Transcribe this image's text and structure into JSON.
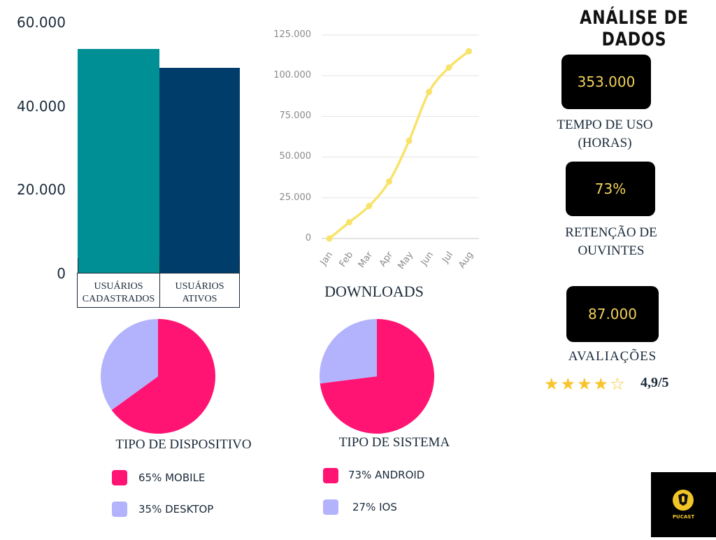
{
  "title": "ANÁLISE DE DADOS",
  "colors": {
    "teal": "#008f94",
    "navy": "#003d6b",
    "yellow": "#f8e36a",
    "pink": "#ff1473",
    "lavender": "#b3b3fd",
    "kpi_text": "#f2d25a"
  },
  "chart_data": [
    {
      "type": "bar",
      "categories": [
        "USUÁRIOS CADASTRADOS",
        "USUÁRIOS ATIVOS"
      ],
      "category_lines": [
        [
          "USUÁRIOS",
          "CADASTRADOS"
        ],
        [
          "USUÁRIOS",
          "ATIVOS"
        ]
      ],
      "values": [
        53500,
        49000
      ],
      "ylim": [
        0,
        60000
      ],
      "yticks": [
        "0",
        "20.000",
        "40.000",
        "60.000"
      ],
      "grid": false
    },
    {
      "type": "line",
      "x": [
        "Jan",
        "Feb",
        "Mar",
        "Apr",
        "May",
        "Jun",
        "Jul",
        "Aug"
      ],
      "values": [
        0,
        10000,
        20000,
        35000,
        60000,
        90000,
        105000,
        115000
      ],
      "ylim": [
        0,
        125000
      ],
      "yticks": [
        "0",
        "25.000",
        "50.000",
        "75.000",
        "100.000",
        "125.000"
      ],
      "xlabel": "DOWNLOADS",
      "grid": true
    },
    {
      "type": "pie",
      "title": "TIPO DE DISPOSITIVO",
      "slices": [
        {
          "label": "65% MOBILE",
          "value": 65,
          "color": "#ff1473"
        },
        {
          "label": "35% DESKTOP",
          "value": 35,
          "color": "#b3b3fd"
        }
      ]
    },
    {
      "type": "pie",
      "title": "TIPO DE SISTEMA",
      "slices": [
        {
          "label": "73% ANDROID",
          "value": 73,
          "color": "#ff1473"
        },
        {
          "label": "27% IOS",
          "value": 27,
          "color": "#b3b3fd"
        }
      ]
    }
  ],
  "kpis": {
    "usage_value": "353.000",
    "usage_label_1": "TEMPO DE USO",
    "usage_label_2": "(HORAS)",
    "retention_value": "73%",
    "retention_label_1": "RETENÇÃO DE",
    "retention_label_2": "OUVINTES",
    "ratings_value": "87.000",
    "ratings_label": "AVALIAÇÕES",
    "rating_score": "4,9/5",
    "stars_filled": 4,
    "stars_total": 5
  },
  "logo": {
    "text": "PUCAST"
  }
}
